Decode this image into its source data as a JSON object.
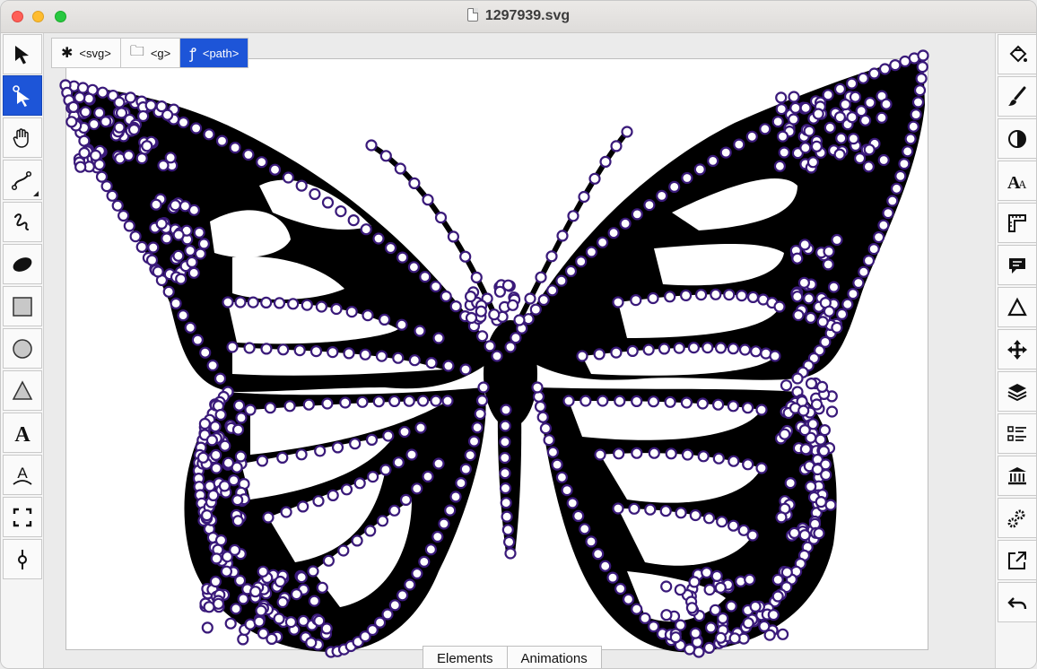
{
  "window": {
    "title": "1297939.svg"
  },
  "breadcrumbs": [
    {
      "label": "<svg>",
      "icon": "asterisk-icon"
    },
    {
      "label": "<g>",
      "icon": "folder-icon"
    },
    {
      "label": "<path>",
      "icon": "path-icon",
      "active": true
    }
  ],
  "left_tools": [
    "select-arrow-icon",
    "node-edit-arrow-icon",
    "hand-pan-icon",
    "pen-curve-icon",
    "freehand-icon",
    "ellipse-filled-icon",
    "rectangle-icon",
    "circle-icon",
    "triangle-icon",
    "text-icon",
    "text-on-path-icon",
    "fit-frame-icon",
    "node-insert-icon"
  ],
  "right_tools": [
    "paint-bucket-icon",
    "brush-icon",
    "contrast-icon",
    "font-size-icon",
    "ruler-icon",
    "comment-icon",
    "triangle-outline-icon",
    "move-cross-icon",
    "layers-icon",
    "list-view-icon",
    "museum-icon",
    "gears-icon",
    "export-icon",
    "undo-icon"
  ],
  "bottom_tabs": {
    "elements": "Elements",
    "animations": "Animations"
  },
  "colors": {
    "accent": "#1d55d8",
    "node_stroke": "#3a1a7a",
    "shape_fill": "#000000"
  }
}
